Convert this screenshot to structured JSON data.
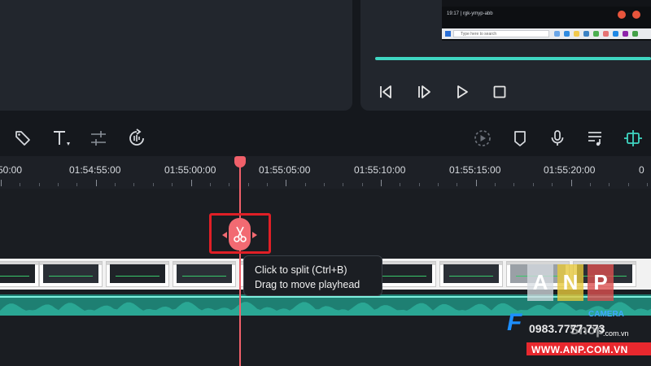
{
  "preview": {
    "call_text": "19:17  |  rgk-ymyp-abb",
    "search_placeholder": "Type here to search",
    "progress_fraction": 1.0
  },
  "playback": {
    "controls": [
      "prev-frame-icon",
      "next-frame-icon",
      "play-icon",
      "stop-icon"
    ]
  },
  "toolbar": {
    "left_tools": [
      "tag-icon",
      "text-icon",
      "adjust-icon",
      "audio-sync-icon"
    ],
    "right_tools": [
      "render-icon",
      "marker-icon",
      "microphone-icon",
      "music-list-icon",
      "snap-icon"
    ]
  },
  "ruler": {
    "labels": [
      "50:00",
      "01:54:55:00",
      "01:55:00:00",
      "01:55:05:00",
      "01:55:10:00",
      "01:55:15:00",
      "01:55:20:00"
    ]
  },
  "tooltip": {
    "line1": "Click to split (Ctrl+B)",
    "line2": "Drag to move playhead"
  },
  "watermark": {
    "letters": [
      "A",
      "N",
      "P"
    ],
    "phone": "0983.7777.773",
    "shop": "Shop",
    "shop_domain": ".com.vn",
    "site": "WWW.ANP.COM.VN",
    "brand_letter": "F",
    "camera_text": "CAMERA"
  },
  "colors": {
    "accent": "#3fd6c2",
    "playhead": "#f0606a",
    "highlight": "#e01f26"
  }
}
